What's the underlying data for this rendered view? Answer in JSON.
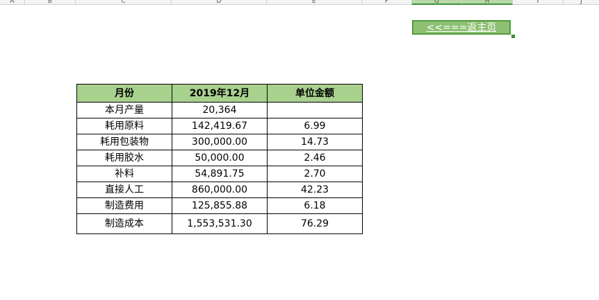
{
  "columns": [
    "A",
    "B",
    "C",
    "D",
    "E",
    "F",
    "G",
    "H",
    "I",
    "J"
  ],
  "home_button": {
    "label": "<<===返主页"
  },
  "table": {
    "headers": [
      "月份",
      "2019年12月",
      "单位金额"
    ],
    "rows": [
      {
        "item": "本月产量",
        "amount": "20,364",
        "unit": ""
      },
      {
        "item": "耗用原料",
        "amount": "142,419.67",
        "unit": "6.99"
      },
      {
        "item": "耗用包装物",
        "amount": "300,000.00",
        "unit": "14.73"
      },
      {
        "item": "耗用胶水",
        "amount": "50,000.00",
        "unit": "2.46"
      },
      {
        "item": "补料",
        "amount": "54,891.75",
        "unit": "2.70"
      },
      {
        "item": "直接人工",
        "amount": "860,000.00",
        "unit": "42.23"
      },
      {
        "item": "制造费用",
        "amount": "125,855.88",
        "unit": "6.18"
      },
      {
        "item": "制造成本",
        "amount": "1,553,531.30",
        "unit": "76.29"
      }
    ]
  }
}
